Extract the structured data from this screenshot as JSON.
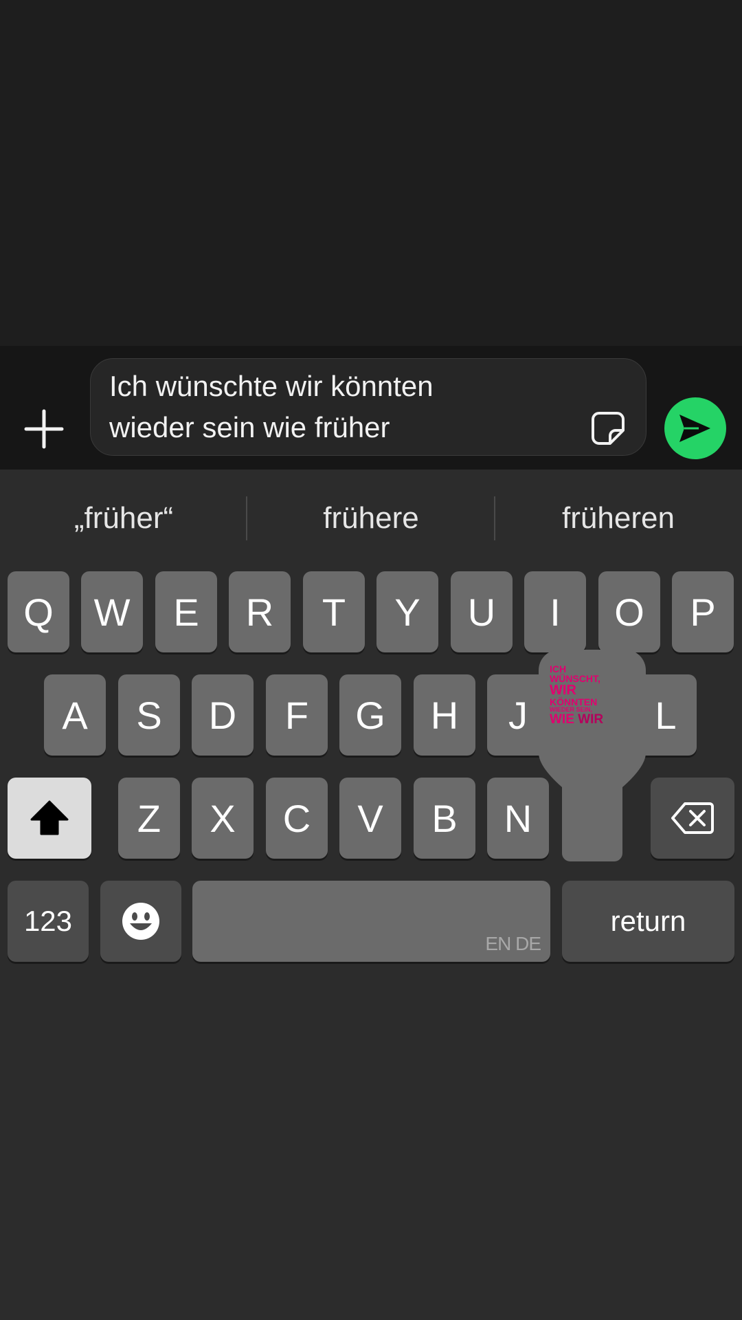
{
  "composer": {
    "input_text": "Ich wünschte wir könnten\nwieder sein wie früher",
    "send_color": "#25d366"
  },
  "suggestions": [
    "„früher“",
    "frühere",
    "früheren"
  ],
  "keyboard": {
    "row1": [
      "Q",
      "W",
      "E",
      "R",
      "T",
      "Y",
      "U",
      "I",
      "O",
      "P"
    ],
    "row2": [
      "A",
      "S",
      "D",
      "F",
      "G",
      "H",
      "J",
      "L"
    ],
    "row3": [
      "Z",
      "X",
      "C",
      "V",
      "B",
      "N"
    ],
    "numbers_label": "123",
    "return_label": "return",
    "space_languages": "EN DE"
  },
  "sticker_popup": {
    "line1": "ICH",
    "line2": "WÜNSCHT,",
    "line3": "WIR",
    "line4": "KÖNNTEN",
    "line5": "WIEDER SEIN,",
    "line6a": "WIE",
    "line6b": "WIR",
    "color": "#e0006f"
  },
  "icons": [
    "plus-icon",
    "sticker-icon",
    "send-icon",
    "shift-icon",
    "backspace-icon",
    "emoji-icon"
  ]
}
